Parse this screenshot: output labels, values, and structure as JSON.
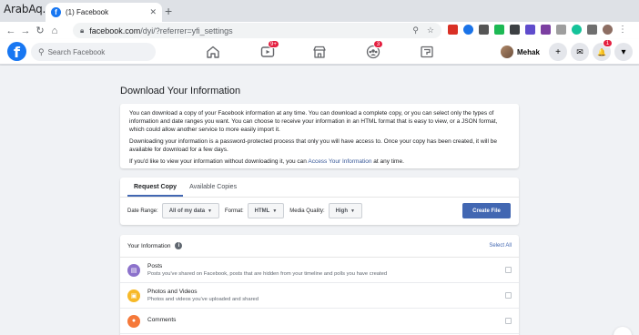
{
  "watermark": "ArabAq.com",
  "browser": {
    "tab_title": "(1) Facebook",
    "tab_favicon": "f",
    "close_glyph": "✕",
    "newtab_glyph": "+",
    "url_host": "facebook.com",
    "url_path": "/dyi/?referrer=yfi_settings"
  },
  "facebook": {
    "logo": "f",
    "search_placeholder": "Search Facebook",
    "watch_badge": "9+",
    "groups_badge": "3",
    "notifications_badge": "1",
    "profile_name": "Mehak",
    "create_glyph": "+",
    "messenger_glyph": "✉",
    "bell_glyph": "🔔",
    "menu_glyph": "▾"
  },
  "page": {
    "title": "Download Your Information",
    "para1": "You can download a copy of your Facebook information at any time. You can download a complete copy, or you can select only the types of information and date ranges you want. You can choose to receive your information in an HTML format that is easy to view, or a JSON format, which could allow another service to more easily import it.",
    "para2": "Downloading your information is a password-protected process that only you will have access to. Once your copy has been created, it will be available for download for a few days.",
    "para3_pre": "If you'd like to view your information without downloading it, you can ",
    "para3_link": "Access Your Information",
    "para3_post": " at any time.",
    "tabs": [
      "Request Copy",
      "Available Copies"
    ],
    "date_range_label": "Date Range:",
    "date_range_value": "All of my data",
    "format_label": "Format:",
    "format_value": "HTML",
    "quality_label": "Media Quality:",
    "quality_value": "High",
    "create_file": "Create File",
    "your_information": "Your Information",
    "info_glyph": "i",
    "select_all": "Select All",
    "items": [
      {
        "name": "Posts",
        "desc": "Posts you've shared on Facebook, posts that are hidden from your timeline and polls you have created",
        "color": "#8c72cb",
        "glyph": "▤"
      },
      {
        "name": "Photos and Videos",
        "desc": "Photos and videos you've uploaded and shared",
        "color": "#f7b928",
        "glyph": "▣"
      },
      {
        "name": "Comments",
        "desc": "",
        "color": "#f5793a",
        "glyph": "●"
      }
    ]
  }
}
